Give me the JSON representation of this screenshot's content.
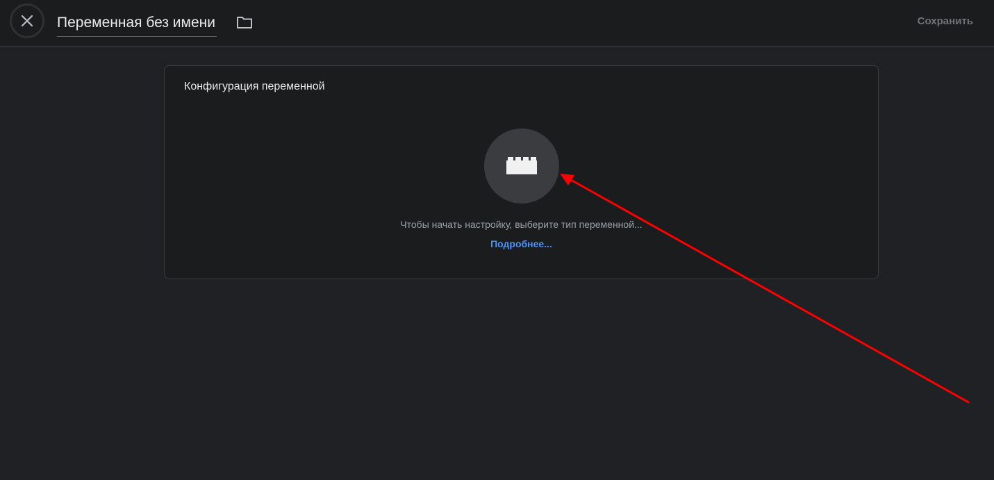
{
  "header": {
    "title": "Переменная без имени",
    "save_label": "Сохранить",
    "close_icon": "close-icon",
    "folder_icon": "folder-icon"
  },
  "card": {
    "title": "Конфигурация переменной",
    "type_icon": "variable-block-icon",
    "hint": "Чтобы начать настройку, выберите тип переменной...",
    "learn_more": "Подробнее..."
  },
  "annotation": {
    "arrow_color": "#ff0000"
  },
  "colors": {
    "background": "#202124",
    "topbar": "#1b1c1e",
    "link": "#4d90fe"
  }
}
